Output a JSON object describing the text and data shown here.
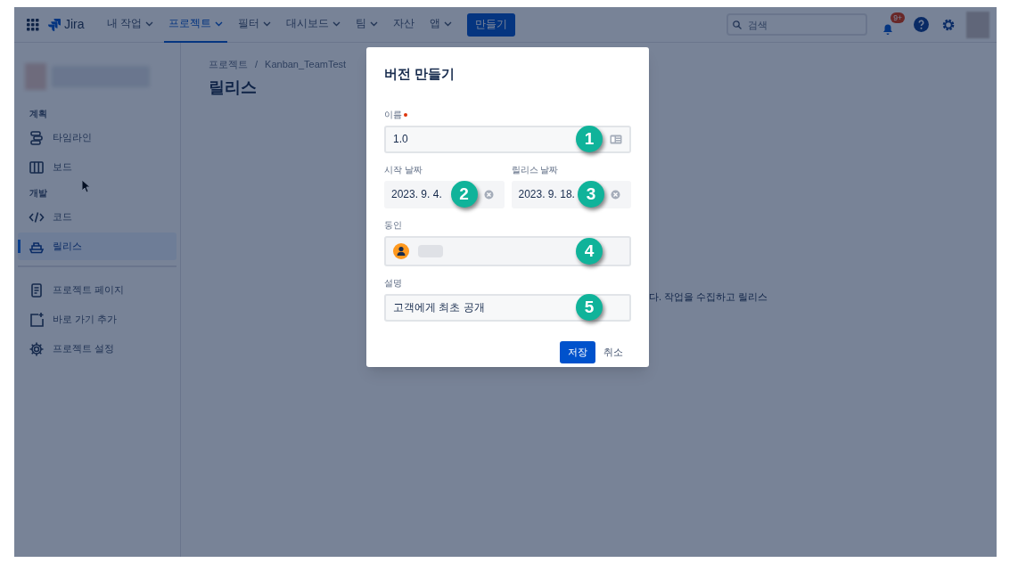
{
  "nav": {
    "product": "Jira",
    "items": [
      {
        "label": "내 작업",
        "dropdown": true,
        "selected": false
      },
      {
        "label": "프로젝트",
        "dropdown": true,
        "selected": true
      },
      {
        "label": "필터",
        "dropdown": true,
        "selected": false
      },
      {
        "label": "대시보드",
        "dropdown": true,
        "selected": false
      },
      {
        "label": "팀",
        "dropdown": true,
        "selected": false
      },
      {
        "label": "자산",
        "dropdown": false,
        "selected": false
      },
      {
        "label": "앱",
        "dropdown": true,
        "selected": false
      }
    ],
    "create_button": "만들기",
    "search": {
      "placeholder": "검색"
    },
    "notification_count": "9+"
  },
  "sidebar": {
    "sections": [
      {
        "title": "계획",
        "items": [
          {
            "label": "타임라인",
            "kind": "timeline",
            "selected": false
          },
          {
            "label": "보드",
            "kind": "board",
            "selected": false
          }
        ]
      },
      {
        "title": "개발",
        "items": [
          {
            "label": "코드",
            "kind": "code",
            "selected": false
          },
          {
            "label": "릴리스",
            "kind": "release",
            "selected": true
          }
        ]
      },
      {
        "items": [
          {
            "label": "프로젝트 페이지",
            "kind": "page",
            "selected": false
          },
          {
            "label": "바로 가기 추가",
            "kind": "shortcut",
            "selected": false
          },
          {
            "label": "프로젝트 설정",
            "kind": "settings",
            "selected": false
          }
        ]
      }
    ]
  },
  "breadcrumbs": {
    "items": [
      "프로젝트",
      "Kanban_TeamTest"
    ],
    "separator": "/"
  },
  "page_title": "릴리스",
  "background_text": "다. 작업을 수집하고 릴리스",
  "dialog": {
    "title": "버전 만들기",
    "rows": [
      [
        {
          "kind": "text",
          "label": "이름",
          "required": true,
          "value": "1.0",
          "badge": "1"
        }
      ],
      [
        {
          "kind": "date",
          "label": "시작 날짜",
          "required": false,
          "value": "2023. 9. 4.",
          "badge": "2"
        },
        {
          "kind": "date",
          "label": "릴리스 날짜",
          "required": false,
          "value": "2023. 9. 18.",
          "badge": "3"
        }
      ],
      [
        {
          "kind": "user",
          "label": "동인",
          "required": false,
          "badge": "4"
        }
      ],
      [
        {
          "kind": "text_plain",
          "label": "설명",
          "required": false,
          "value": "고객에게 최초 공개",
          "badge": "5"
        }
      ]
    ],
    "save": "저장",
    "cancel": "취소"
  }
}
